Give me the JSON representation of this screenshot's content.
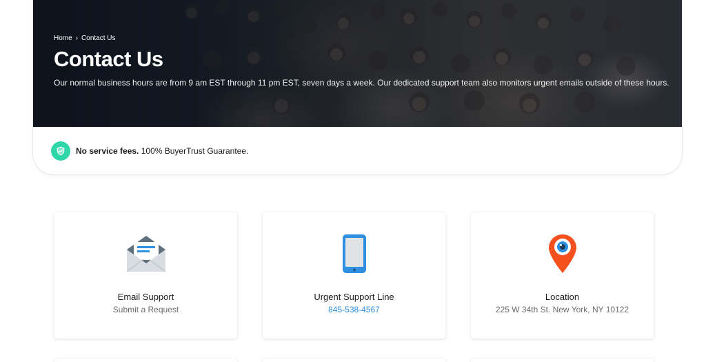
{
  "hero": {
    "breadcrumb": {
      "home": "Home",
      "separator": "›",
      "current": "Contact Us"
    },
    "title": "Contact Us",
    "description": "Our normal business hours are from 9 am EST through 11 pm EST, seven days a week. Our dedicated support team also monitors urgent emails outside of these hours."
  },
  "guarantee": {
    "icon": "shield-check-icon",
    "bold": "No service fees.",
    "text": " 100% BuyerTrust Guarantee.",
    "color": "#2fd6a8"
  },
  "cards": [
    {
      "icon": "envelope-icon",
      "title": "Email Support",
      "subtitle": "Submit a Request"
    },
    {
      "icon": "phone-icon",
      "title": "Urgent Support Line",
      "subtitle": "845-538-4567"
    },
    {
      "icon": "location-pin-icon",
      "title": "Location",
      "subtitle": "225 W 34th St. New York, NY 10122"
    }
  ],
  "colors": {
    "link": "#2f8fe0",
    "accent_green": "#2fd6a8",
    "pin_orange": "#f4511e"
  }
}
